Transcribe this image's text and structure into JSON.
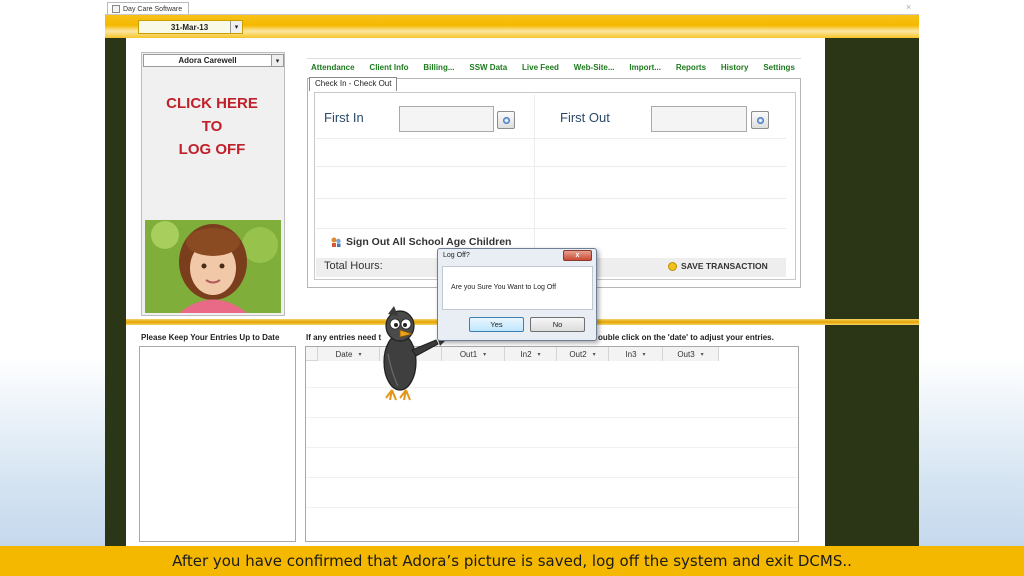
{
  "window": {
    "tab_title": "Day Care Software",
    "close_glyph": "×"
  },
  "header": {
    "date": "31-Mar-13",
    "dropdown_glyph": "▾"
  },
  "user_panel": {
    "selected_user": "Adora Carewell",
    "logoff_text": "CLICK HERE\nTO\nLOG OFF",
    "photo_alt": "child photo"
  },
  "tabs": [
    {
      "label": "Attendance"
    },
    {
      "label": "Client Info"
    },
    {
      "label": "Billing..."
    },
    {
      "label": "SSW Data"
    },
    {
      "label": "Live Feed"
    },
    {
      "label": "Web-Site..."
    },
    {
      "label": "Import..."
    },
    {
      "label": "Reports"
    },
    {
      "label": "History"
    },
    {
      "label": "Settings"
    }
  ],
  "checkin": {
    "subtab_label": "Check In - Check Out",
    "first_in_label": "First In",
    "first_in_value": "",
    "first_out_label": "First Out",
    "first_out_value": "",
    "sign_out_all": "Sign Out All School Age Children",
    "total_hours_label": "Total Hours:",
    "save_label": "SAVE TRANSACTION"
  },
  "bottom": {
    "keep_up_label": "Please Keep Your Entries Up to Date",
    "entries_label_left": "If any entries need t",
    "entries_label_right": "ouble click on the 'date' to adjust your entries."
  },
  "grid": {
    "columns": [
      "Date",
      "",
      "Out1",
      "In2",
      "Out2",
      "In3",
      "Out3"
    ],
    "sort_glyph": "▾"
  },
  "dialog": {
    "title": "Log Off?",
    "message": "Are you Sure You Want to Log Off",
    "yes_label": "Yes",
    "no_label": "No",
    "close_glyph": "x"
  },
  "caption": "After you have confirmed that Adora’s picture is saved, log off the system and exit DCMS..",
  "colors": {
    "frame": "#2b3616",
    "accent_yellow": "#f5b800",
    "logoff_red": "#c0202a",
    "tab_green": "#1d7a1d"
  }
}
